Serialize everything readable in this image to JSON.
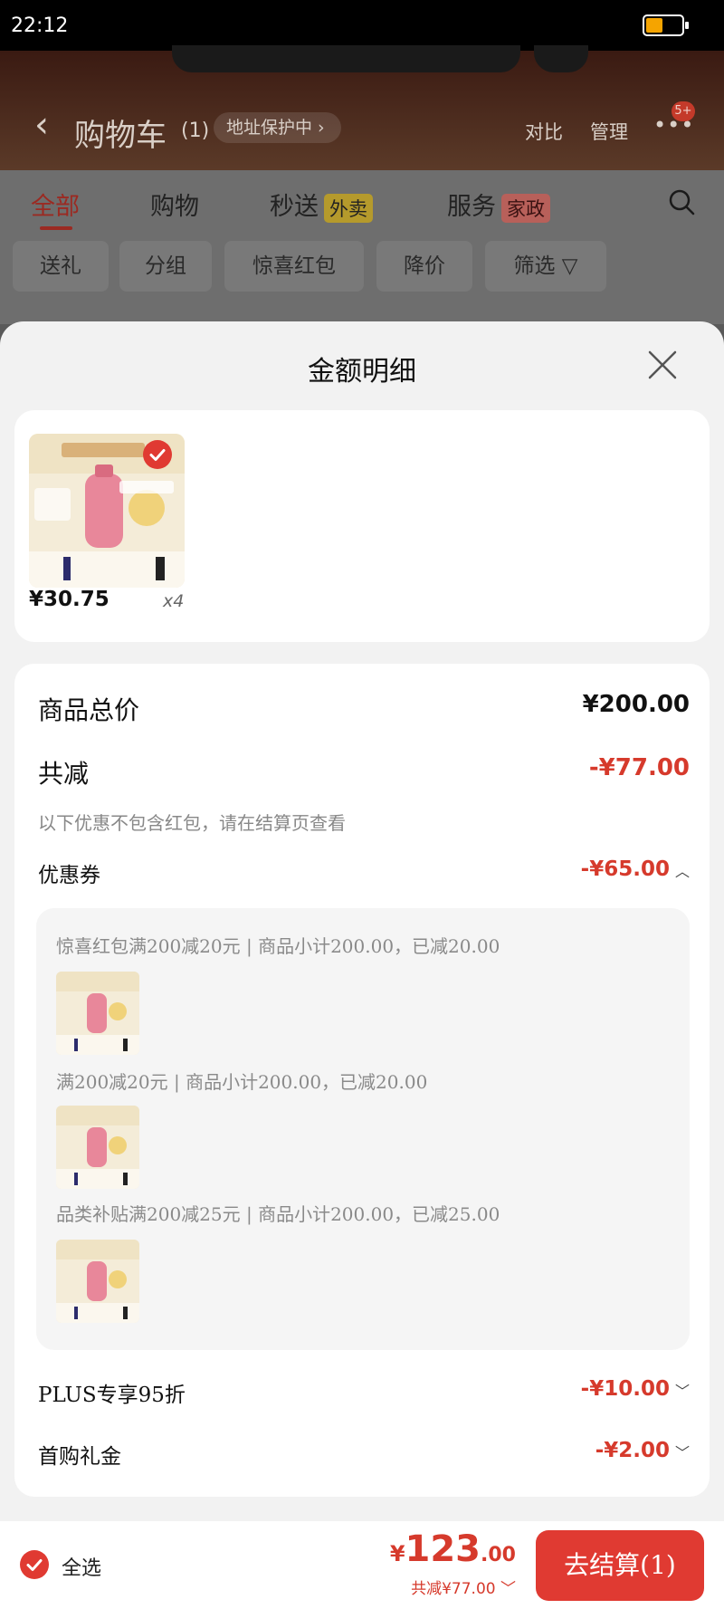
{
  "status_bar": {
    "time": "22:12"
  },
  "background_app": {
    "title": "购物车",
    "count": "(1)",
    "address_protect": "地址保护中",
    "compare": "对比",
    "manage": "管理",
    "more_badge": "5+",
    "tabs": [
      {
        "label": "全部",
        "active": true
      },
      {
        "label": "购物"
      },
      {
        "label": "秒送",
        "tag": "外卖"
      },
      {
        "label": "服务",
        "tag": "家政"
      }
    ],
    "chips": [
      "送礼",
      "分组",
      "惊喜红包",
      "降价",
      "筛选"
    ]
  },
  "sheet": {
    "title": "金额明细",
    "product": {
      "price": "¥30.75",
      "quantity": "x4"
    },
    "total_label": "商品总价",
    "total_value": "¥200.00",
    "discount_label": "共减",
    "discount_value": "-¥77.00",
    "discount_note": "以下优惠不包含红包，请在结算页查看",
    "coupon_label": "优惠券",
    "coupon_value": "-¥65.00",
    "coupon_items": [
      "惊喜红包满200减20元 | 商品小计200.00，已减20.00",
      "满200减20元 | 商品小计200.00，已减20.00",
      "品类补贴满200减25元 | 商品小计200.00，已减25.00"
    ],
    "plus_label": "PLUS专享95折",
    "plus_value": "-¥10.00",
    "first_label": "首购礼金",
    "first_value": "-¥2.00"
  },
  "bottom_bar": {
    "select_all": "全选",
    "currency": "¥",
    "total_int": "123",
    "total_dec": ".00",
    "saved": "共减¥77.00",
    "checkout": "去结算(1)"
  },
  "colors": {
    "accent": "#e03a32",
    "discount": "#d63a2c"
  }
}
